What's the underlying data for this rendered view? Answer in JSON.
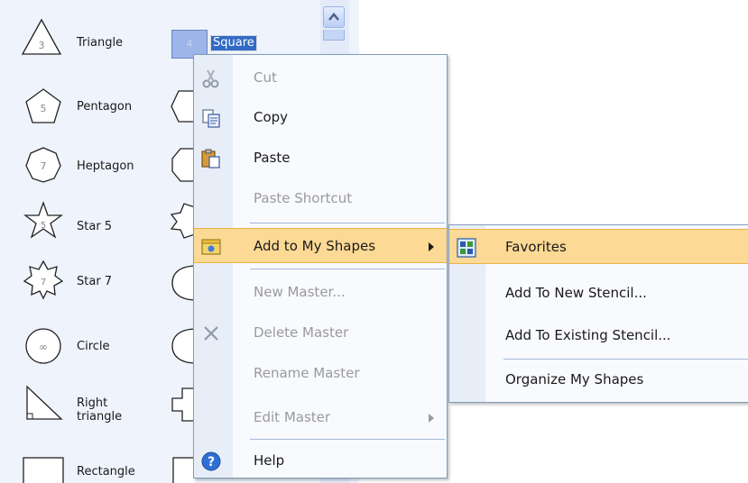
{
  "stencil": {
    "shapes_left": [
      {
        "label": "Triangle",
        "icon": "triangle-icon",
        "badge": "3"
      },
      {
        "label": "Pentagon",
        "icon": "pentagon-icon",
        "badge": "5"
      },
      {
        "label": "Heptagon",
        "icon": "heptagon-icon",
        "badge": "7"
      },
      {
        "label": "Star 5",
        "icon": "star5-icon",
        "badge": "5"
      },
      {
        "label": "Star 7",
        "icon": "star7-icon",
        "badge": "7"
      },
      {
        "label": "Circle",
        "icon": "circle-icon",
        "badge": "∞"
      },
      {
        "label": "Right\ntriangle",
        "icon": "right-triangle-icon",
        "badge": ""
      },
      {
        "label": "Rectangle",
        "icon": "rectangle-icon",
        "badge": ""
      }
    ],
    "shapes_right_partial": [
      {
        "icon": "hexagon-icon",
        "badge": "6"
      },
      {
        "icon": "octagon-icon",
        "badge": "8"
      },
      {
        "icon": "star6-icon",
        "badge": ""
      },
      {
        "icon": "ellipse-icon",
        "badge": ""
      },
      {
        "icon": "ellipse-icon",
        "badge": "c"
      },
      {
        "icon": "cross-icon",
        "badge": ""
      },
      {
        "icon": "rectangle-icon",
        "badge": ""
      }
    ],
    "selected_shape": {
      "label": "Square",
      "badge": "4"
    }
  },
  "context_menu": {
    "items": [
      {
        "label": "Cut",
        "mnemonic_index": 2,
        "icon": "scissors-icon",
        "disabled": true
      },
      {
        "label": "Copy",
        "mnemonic_index": 0,
        "icon": "copy-icon",
        "disabled": false
      },
      {
        "label": "Paste",
        "mnemonic_index": 0,
        "icon": "paste-icon",
        "disabled": false
      },
      {
        "label": "Paste Shortcut",
        "mnemonic_index": 9,
        "icon": "",
        "disabled": true
      },
      {
        "label": "Add to My Shapes",
        "mnemonic_index": 7,
        "icon": "my-shapes-icon",
        "disabled": false,
        "submenu": true,
        "highlighted": true
      },
      {
        "label": "New Master...",
        "mnemonic_index": 0,
        "icon": "",
        "disabled": true
      },
      {
        "label": "Delete Master",
        "mnemonic_index": 0,
        "icon": "delete-icon",
        "disabled": true
      },
      {
        "label": "Rename Master",
        "mnemonic_index": 0,
        "icon": "",
        "disabled": true
      },
      {
        "label": "Edit Master",
        "mnemonic_index": 0,
        "icon": "",
        "disabled": true,
        "submenu": true
      },
      {
        "label": "Help",
        "mnemonic_index": 0,
        "icon": "help-icon",
        "disabled": false
      }
    ]
  },
  "submenu": {
    "items": [
      {
        "label": "Favorites",
        "mnemonic_index": -1,
        "icon": "favorites-icon",
        "highlighted": true
      },
      {
        "label": "Add To New Stencil...",
        "mnemonic_index": 7
      },
      {
        "label": "Add To Existing Stencil...",
        "mnemonic_index": 7
      },
      {
        "label": "Organize My Shapes",
        "mnemonic_index": 0
      }
    ]
  },
  "colors": {
    "highlight": "#fcd994",
    "selection": "#316ac5",
    "disabled_text": "#9a9a9a"
  }
}
